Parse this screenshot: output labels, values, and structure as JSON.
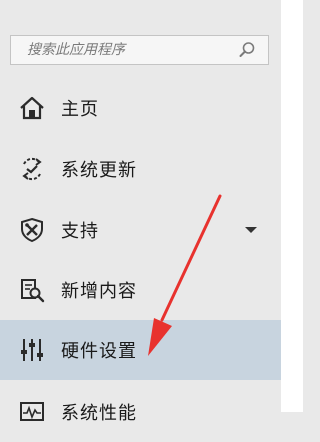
{
  "search": {
    "placeholder": "搜索此应用程序",
    "icon": "search-icon"
  },
  "nav": {
    "items": [
      {
        "label": "主页",
        "icon": "home-icon"
      },
      {
        "label": "系统更新",
        "icon": "sync-icon"
      },
      {
        "label": "支持",
        "icon": "support-shield-icon",
        "expandable": true
      },
      {
        "label": "新增内容",
        "icon": "whats-new-icon"
      },
      {
        "label": "硬件设置",
        "icon": "sliders-icon",
        "selected": true
      },
      {
        "label": "系统性能",
        "icon": "performance-icon"
      }
    ]
  },
  "colors": {
    "sidebar_bg": "#e9e9e9",
    "selected_bg": "#c8d4df",
    "annotation_arrow": "#e8322e"
  }
}
